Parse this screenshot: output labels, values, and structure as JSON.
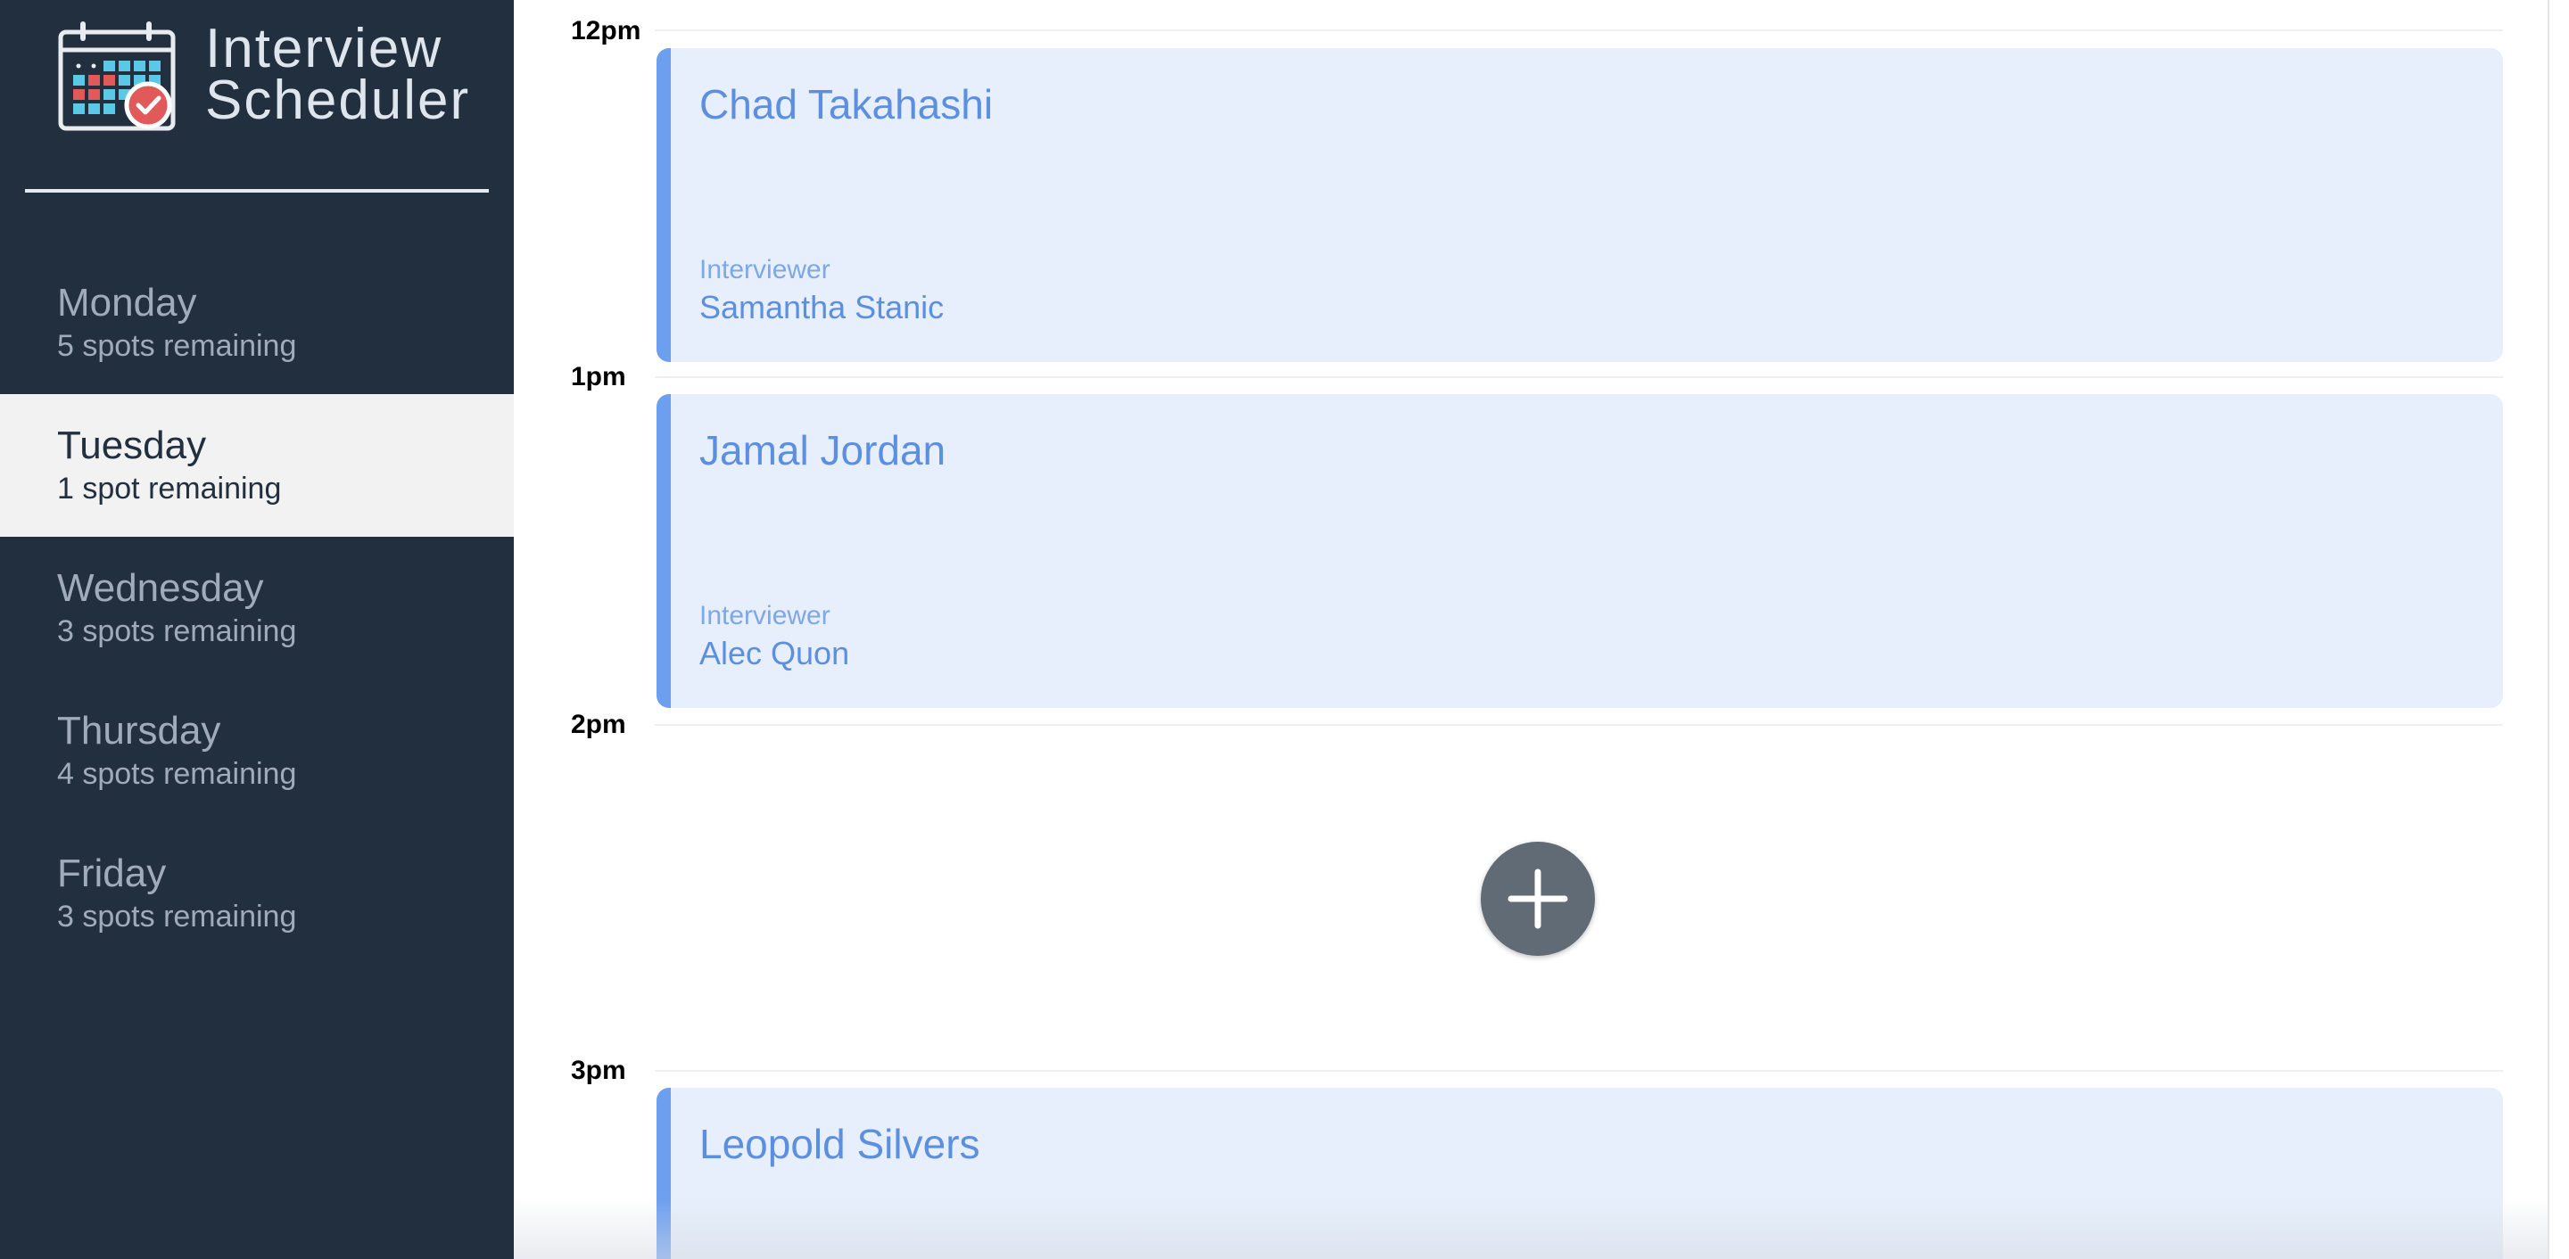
{
  "app": {
    "title_line1": "Interview",
    "title_line2": "Scheduler",
    "icon": "calendar-check-icon"
  },
  "days": [
    {
      "name": "Monday",
      "spots": "5 spots remaining",
      "selected": false
    },
    {
      "name": "Tuesday",
      "spots": "1 spot remaining",
      "selected": true
    },
    {
      "name": "Wednesday",
      "spots": "3 spots remaining",
      "selected": false
    },
    {
      "name": "Thursday",
      "spots": "4 spots remaining",
      "selected": false
    },
    {
      "name": "Friday",
      "spots": "3 spots remaining",
      "selected": false
    }
  ],
  "schedule": {
    "hours": [
      "12pm",
      "1pm",
      "2pm",
      "3pm"
    ],
    "appointments": [
      {
        "student": "Chad Takahashi",
        "interviewer_label": "Interviewer",
        "interviewer": "Samantha Stanic"
      },
      {
        "student": "Jamal Jordan",
        "interviewer_label": "Interviewer",
        "interviewer": "Alec Quon"
      },
      {
        "student": "Leopold Silvers"
      }
    ],
    "add_icon": "plus-icon"
  },
  "colors": {
    "sidebar_bg": "#222f3e",
    "selected_day_bg": "#f2f2f2",
    "appointment_bg": "#e6effb",
    "appointment_accent": "#6c9ff0",
    "add_button_bg": "#616b75"
  }
}
